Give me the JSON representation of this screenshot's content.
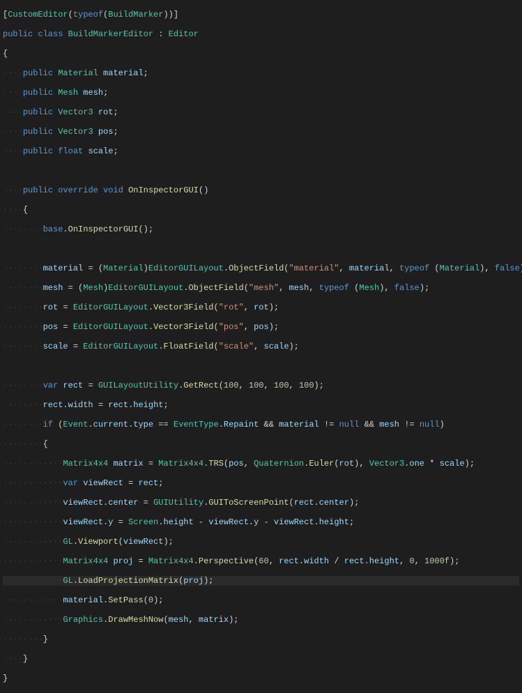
{
  "code": {
    "l1": {
      "attr": "CustomEditor",
      "tof": "typeof",
      "cls": "BuildMarker"
    },
    "l2": {
      "pub": "public",
      "cls": "class",
      "name": "BuildMarkerEditor",
      "col": ":",
      "base": "Editor"
    },
    "l3": "{",
    "l4": {
      "pub": "public",
      "type": "Material",
      "name": "material"
    },
    "l5": {
      "pub": "public",
      "type": "Mesh",
      "name": "mesh"
    },
    "l6": {
      "pub": "public",
      "type": "Vector3",
      "name": "rot"
    },
    "l7": {
      "pub": "public",
      "type": "Vector3",
      "name": "pos"
    },
    "l8": {
      "pub": "public",
      "type": "float",
      "name": "scale"
    },
    "l9": "",
    "l10": {
      "pub": "public",
      "ov": "override",
      "void": "void",
      "name": "OnInspectorGUI"
    },
    "l11": "{",
    "l12": {
      "base": "base",
      "m": "OnInspectorGUI"
    },
    "l13": "",
    "l14": {
      "lhs": "material",
      "cast": "Material",
      "t": "EditorGUILayout",
      "m": "ObjectField",
      "s": "\"material\"",
      "a2": "material",
      "tof": "typeof",
      "tt": "Material",
      "f": "false"
    },
    "l15": {
      "lhs": "mesh",
      "cast": "Mesh",
      "t": "EditorGUILayout",
      "m": "ObjectField",
      "s": "\"mesh\"",
      "a2": "mesh",
      "tof": "typeof",
      "tt": "Mesh",
      "f": "false"
    },
    "l16": {
      "lhs": "rot",
      "t": "EditorGUILayout",
      "m": "Vector3Field",
      "s": "\"rot\"",
      "a2": "rot"
    },
    "l17": {
      "lhs": "pos",
      "t": "EditorGUILayout",
      "m": "Vector3Field",
      "s": "\"pos\"",
      "a2": "pos"
    },
    "l18": {
      "lhs": "scale",
      "t": "EditorGUILayout",
      "m": "FloatField",
      "s": "\"scale\"",
      "a2": "scale"
    },
    "l19": "",
    "l20": {
      "var": "var",
      "lhs": "rect",
      "t": "GUILayoutUtility",
      "m": "GetRect",
      "n1": "100",
      "n2": "100",
      "n3": "100",
      "n4": "100"
    },
    "l21": {
      "o": "rect",
      "p1": "width",
      "o2": "rect",
      "p2": "height"
    },
    "l22": {
      "if": "if",
      "t": "Event",
      "p1": "current",
      "p2": "type",
      "eq": "==",
      "t2": "EventType",
      "p3": "Repaint",
      "and": "&&",
      "a": "material",
      "ne": "!=",
      "nu": "null",
      "b": "mesh"
    },
    "l23": "{",
    "l24": {
      "type": "Matrix4x4",
      "lhs": "matrix",
      "t": "Matrix4x4",
      "m": "TRS",
      "a1": "pos",
      "t2": "Quaternion",
      "m2": "Euler",
      "a2": "rot",
      "t3": "Vector3",
      "p3": "one",
      "mul": "*",
      "a3": "scale"
    },
    "l25": {
      "var": "var",
      "lhs": "viewRect",
      "rhs": "rect"
    },
    "l26": {
      "o": "viewRect",
      "p": "center",
      "t": "GUIUtility",
      "m": "GUIToScreenPoint",
      "a": "rect",
      "ap": "center"
    },
    "l27": {
      "o": "viewRect",
      "p": "y",
      "t": "Screen",
      "tp": "height",
      "o2": "viewRect",
      "p2": "y",
      "o3": "viewRect",
      "p3": "height"
    },
    "l28": {
      "t": "GL",
      "m": "Viewport",
      "a": "viewRect"
    },
    "l29": {
      "type": "Matrix4x4",
      "lhs": "proj",
      "t": "Matrix4x4",
      "m": "Perspective",
      "n1": "60",
      "a": "rect",
      "ap": "width",
      "a2": "rect",
      "ap2": "height",
      "n2": "0",
      "n3": "1000f"
    },
    "l30": {
      "t": "GL",
      "m": "LoadProjectionMatrix",
      "a": "proj"
    },
    "l31": {
      "o": "material",
      "m": "SetPass",
      "n": "0"
    },
    "l32": {
      "t": "Graphics",
      "m": "DrawMeshNow",
      "a1": "mesh",
      "a2": "matrix"
    },
    "l33": "}",
    "l34": "}",
    "l35": "}"
  }
}
